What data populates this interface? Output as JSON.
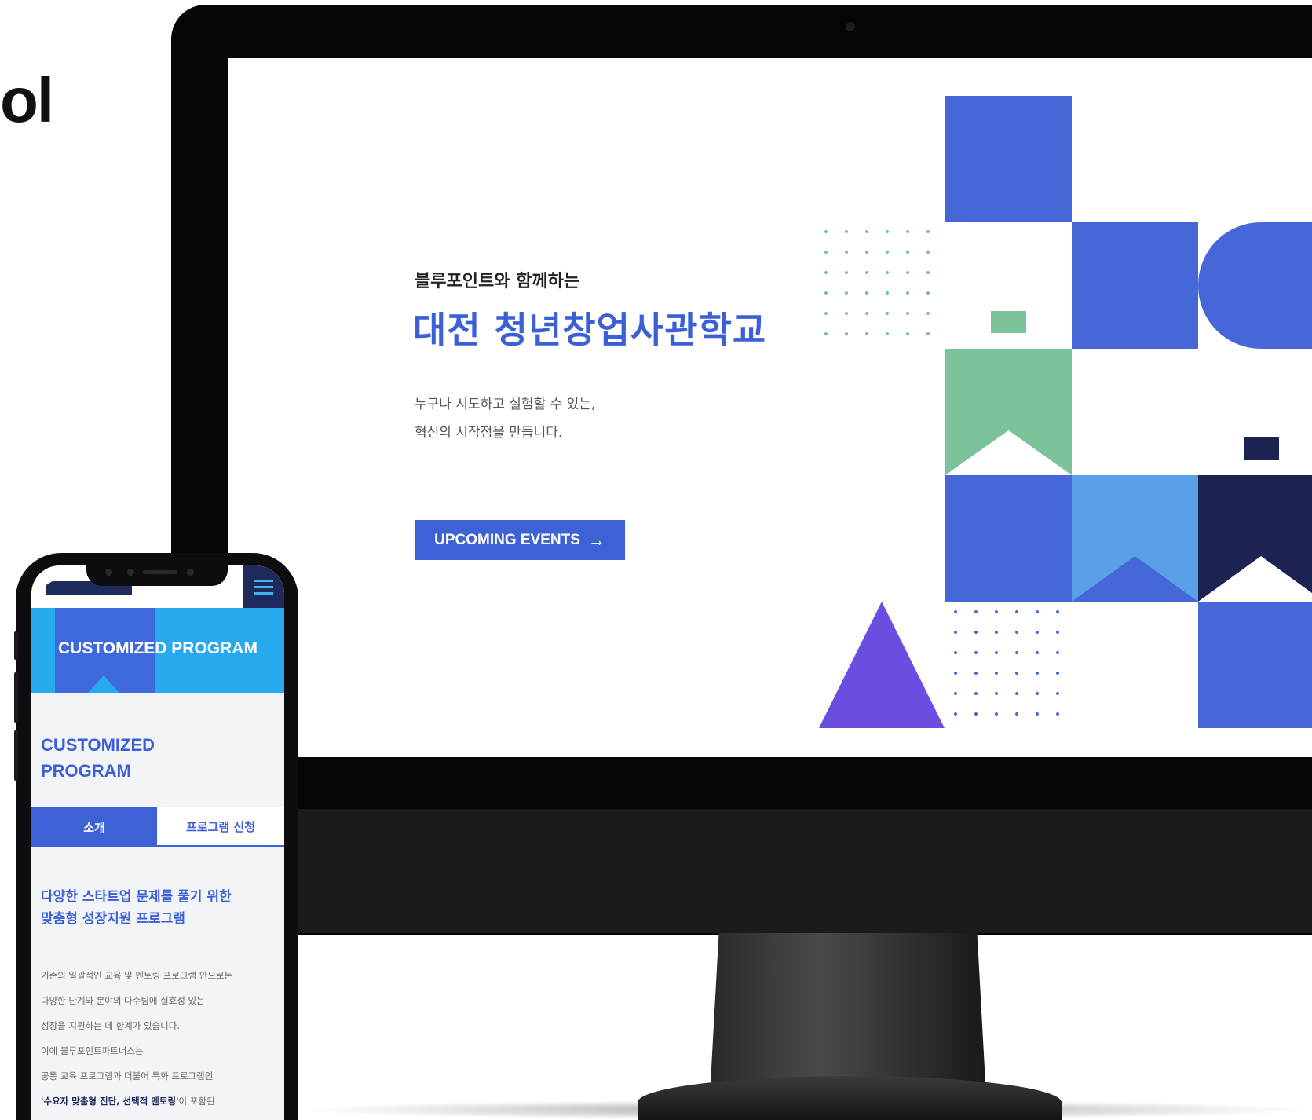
{
  "left_title": "ol",
  "hero": {
    "subtitle": "블루포인트와 함께하는",
    "title": "대전 청년창업사관학교",
    "desc_line1": "누구나 시도하고 실험할 수 있는,",
    "desc_line2": "혁신의 시작점을 만듭니다.",
    "cta_label": "UPCOMING EVENTS",
    "cta_arrow": "→"
  },
  "colors": {
    "blue": "#4567d8",
    "light_blue": "#5aa0e6",
    "navy": "#1c2353",
    "green": "#7cc29b",
    "purple": "#6b4ee0",
    "dot_green": "#6cc39a",
    "dot_blue": "#3f6ae0"
  },
  "mobile": {
    "banner_title": "CUSTOMIZED PROGRAM",
    "heading_line1": "CUSTOMIZED",
    "heading_line2": "PROGRAM",
    "tab_intro": "소개",
    "tab_apply": "프로그램 신청",
    "sub_line1": "다양한 스타트업 문제를 풀기 위한",
    "sub_line2": "맞춤형 성장지원 프로그램",
    "body_line1": "기존의 일괄적인 교육 및 멘토링 프로그램 만으로는",
    "body_line2": "다양한 단계와 분야의 다수팀에 실효성 있는",
    "body_line3": "성장을 지원하는 데 한계가 있습니다.",
    "body_line4": "이에 블루포인트파트너스는",
    "body_line5": "공통 교육 프로그램과 더불어 특화 프로그램인",
    "body_line6_em": "'수요자 맞춤형 진단, 선택적 멘토링'",
    "body_line6_rest": "이 포함된"
  }
}
